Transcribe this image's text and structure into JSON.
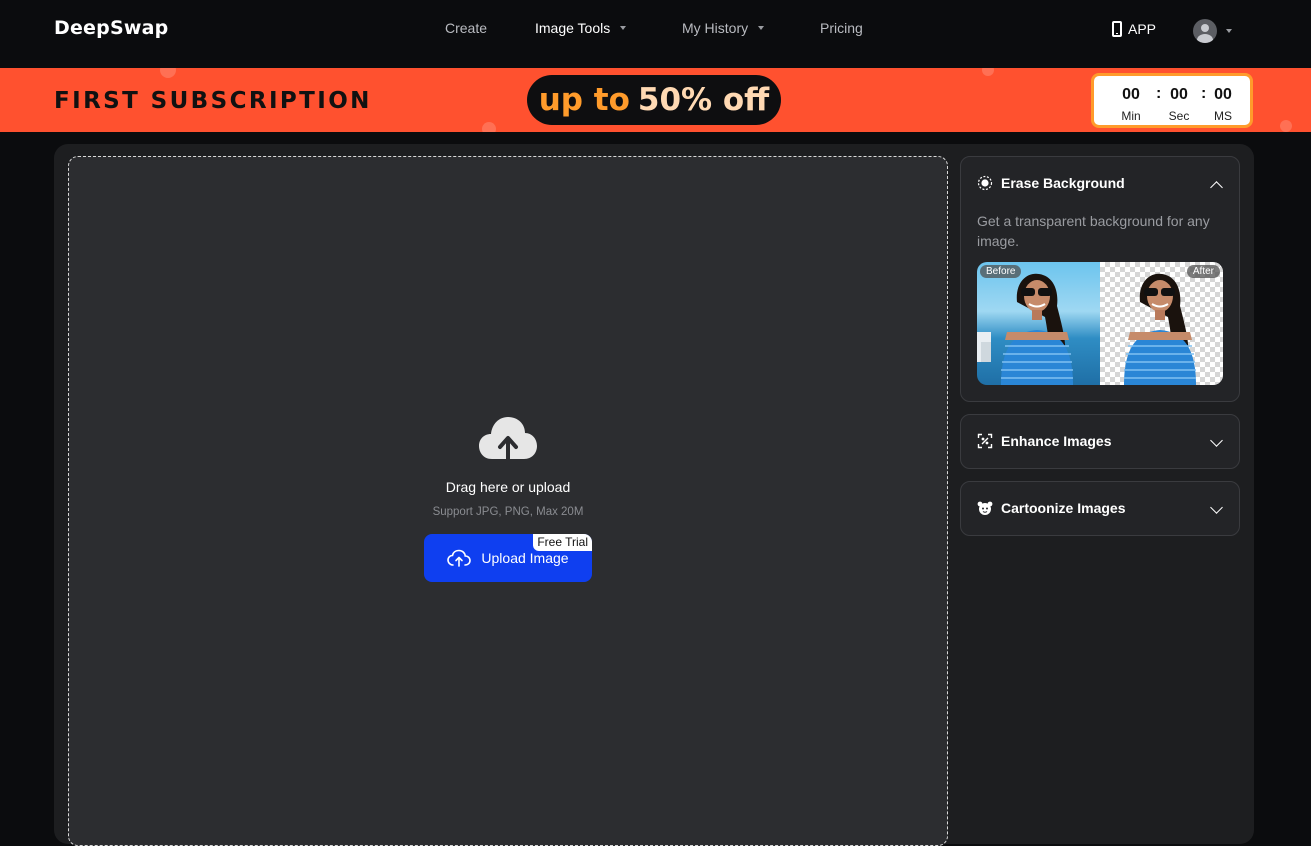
{
  "brand": {
    "logo": "DeepSwap"
  },
  "nav": {
    "items": [
      {
        "label": "Create",
        "dropdown": false,
        "active": false
      },
      {
        "label": "Image Tools",
        "dropdown": true,
        "active": true
      },
      {
        "label": "My History",
        "dropdown": true,
        "active": false
      },
      {
        "label": "Pricing",
        "dropdown": false,
        "active": false
      }
    ],
    "app_label": "APP"
  },
  "promo": {
    "title": "FIRST SUBSCRIPTION",
    "offer_part1": "up to",
    "offer_part2": "50% off",
    "timer": {
      "min": "00",
      "sec": "00",
      "ms": "00",
      "min_label": "Min",
      "sec_label": "Sec",
      "ms_label": "MS",
      "separator": ":"
    }
  },
  "upload": {
    "drag_text": "Drag here or upload",
    "support_text": "Support JPG, PNG, Max 20M",
    "button_label": "Upload Image",
    "badge": "Free Trial"
  },
  "tools": {
    "erase": {
      "title": "Erase Background",
      "expanded": true,
      "description": "Get a transparent background for any image.",
      "before_label": "Before",
      "after_label": "After"
    },
    "enhance": {
      "title": "Enhance Images",
      "expanded": false
    },
    "cartoonize": {
      "title": "Cartoonize Images",
      "expanded": false
    }
  },
  "colors": {
    "accent_blue": "#0f3ff0",
    "promo_orange": "#ff512f",
    "timer_border": "#ff9b2b",
    "background": "#0b0c0e"
  }
}
